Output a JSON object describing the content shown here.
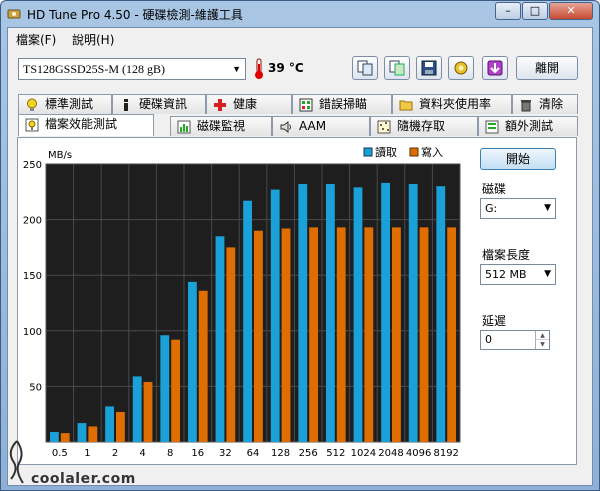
{
  "window": {
    "title": "HD Tune Pro 4.50 - 硬碟檢測-維護工具",
    "minimize": "–",
    "maximize": "□",
    "close": "✕"
  },
  "menu": [
    {
      "label": "檔案(F)"
    },
    {
      "label": "說明(H)"
    }
  ],
  "toolbar": {
    "drive": "TS128GSSD25S-M (128 gB)",
    "temperature": "39 °C",
    "exit_label": "離開",
    "icons": [
      "copy-info-icon",
      "copy-screenshot-icon",
      "save-icon",
      "options-icon",
      "download-icon"
    ]
  },
  "tabs_top": [
    {
      "label": "標準測試",
      "icon": "bulb-icon"
    },
    {
      "label": "硬碟資訊",
      "icon": "info-icon"
    },
    {
      "label": "健康",
      "icon": "health-cross-icon"
    },
    {
      "label": "錯誤掃瞄",
      "icon": "scan-icon"
    },
    {
      "label": "資料夾使用率",
      "icon": "folder-icon"
    },
    {
      "label": "清除",
      "icon": "trash-icon"
    }
  ],
  "tabs_bottom": [
    {
      "label": "檔案效能測試",
      "icon": "file-benchmark-icon",
      "active": true
    },
    {
      "label": "磁碟監視",
      "icon": "monitor-icon"
    },
    {
      "label": "AAM",
      "icon": "speaker-icon"
    },
    {
      "label": "隨機存取",
      "icon": "random-access-icon"
    },
    {
      "label": "額外測試",
      "icon": "extra-test-icon"
    }
  ],
  "side": {
    "start_label": "開始",
    "disk_label": "磁碟",
    "disk_value": "G:",
    "file_length_label": "檔案長度",
    "file_length_value": "512 MB",
    "delay_label": "延遲",
    "delay_value": "0"
  },
  "watermark": {
    "text": "coolaler.com"
  },
  "colors": {
    "read": "#1aa1d8",
    "write": "#e06d00",
    "plot_bg": "#1e1e1e"
  },
  "chart_data": {
    "type": "bar",
    "ylabel": "MB/s",
    "ylim": [
      0,
      250
    ],
    "yticks": [
      50,
      100,
      150,
      200,
      250
    ],
    "categories": [
      "0.5",
      "1",
      "2",
      "4",
      "8",
      "16",
      "32",
      "64",
      "128",
      "256",
      "512",
      "1024",
      "2048",
      "4096",
      "8192"
    ],
    "series": [
      {
        "name": "讀取",
        "values": [
          9,
          17,
          32,
          59,
          96,
          144,
          185,
          217,
          227,
          232,
          232,
          229,
          233,
          232,
          230
        ]
      },
      {
        "name": "寫入",
        "values": [
          8,
          14,
          27,
          54,
          92,
          136,
          175,
          190,
          192,
          193,
          193,
          193,
          193,
          193,
          193
        ]
      }
    ],
    "legend": "top-right",
    "grid": true
  }
}
